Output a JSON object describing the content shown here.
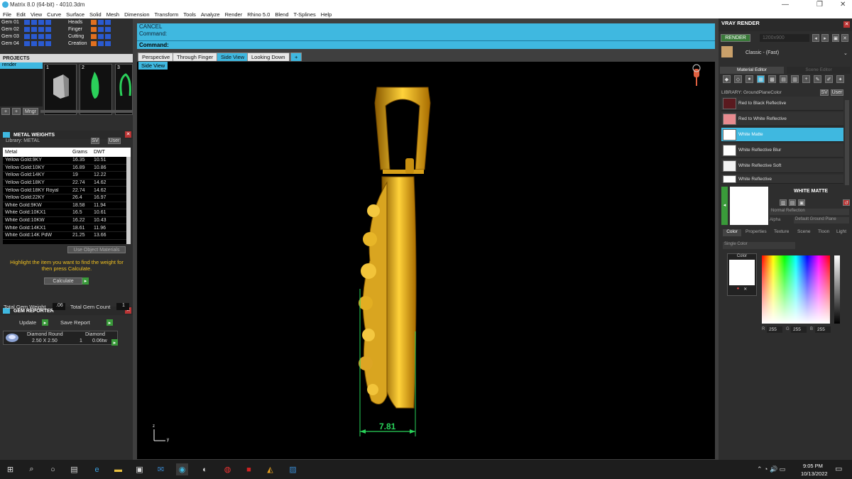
{
  "window": {
    "title": "Matrix 8.0 (64-bit) - 4010.3dm",
    "min": "—",
    "max": "❐",
    "close": "✕"
  },
  "menu": [
    "File",
    "Edit",
    "View",
    "Curve",
    "Surface",
    "Solid",
    "Mesh",
    "Dimension",
    "Transform",
    "Tools",
    "Analyze",
    "Render",
    "Rhino 5.0",
    "Blend",
    "T-Splines",
    "Help"
  ],
  "gems_left": [
    "Gem 01",
    "Gem 02",
    "Gem 03",
    "Gem 04"
  ],
  "gems_right": [
    "Heads",
    "Finger",
    "Cutting",
    "Creation"
  ],
  "projects": {
    "title": "PROJECTS",
    "item": "render",
    "thumb_nums": [
      "1",
      "2",
      "3"
    ],
    "mngr": "Mngr"
  },
  "metal_weights": {
    "title": "METAL WEIGHTS",
    "library_label": "Library: METAL",
    "sv": "SV",
    "user": "User",
    "headers": [
      "Metal",
      "Grams",
      "DWT"
    ],
    "rows": [
      [
        "Yellow Gold:9KY",
        "16.35",
        "10.51"
      ],
      [
        "Yellow Gold:10KY",
        "16.89",
        "10.86"
      ],
      [
        "Yellow Gold:14KY",
        "19",
        "12.22"
      ],
      [
        "Yellow Gold:18KY",
        "22.74",
        "14.62"
      ],
      [
        "Yellow Gold:18KY Royal",
        "22.74",
        "14.62"
      ],
      [
        "Yellow Gold:22KY",
        "26.4",
        "16.97"
      ],
      [
        "White Gold:9KW",
        "18.58",
        "11.94"
      ],
      [
        "White Gold:10KX1",
        "16.5",
        "10.61"
      ],
      [
        "White Gold:10KW",
        "16.22",
        "10.43"
      ],
      [
        "White Gold:14KX1",
        "18.61",
        "11.96"
      ],
      [
        "White Gold:14K PdW",
        "21.25",
        "13.66"
      ]
    ],
    "use_object": "Use Object Materials",
    "hint": "Highlight the item you want to find the weight for then press Calculate.",
    "calculate": "Calculate"
  },
  "gem_reporter": {
    "title": "GEM REPORTER",
    "total_weight_label": "Total Gem Weight",
    "total_weight_value": ".06",
    "total_count_label": "Total Gem Count",
    "total_count_value": "1",
    "update": "Update",
    "save_report": "Save Report",
    "headers": [
      "Diamond Round",
      "Diamond"
    ],
    "row": {
      "size": "2.50 X 2.50",
      "qty": "1",
      "ct": "0.06tw"
    }
  },
  "command": {
    "line1": "CANCEL",
    "line2": "Command:",
    "prompt": "Command:"
  },
  "viewport_tabs": [
    "Perspective",
    "Through Finger",
    "Side View",
    "Looking Down",
    "+"
  ],
  "active_view": "Side View",
  "viewport_label": "Side View",
  "dimension": "7.81",
  "axis": {
    "z": "z",
    "y": "y"
  },
  "vray": {
    "title": "VRAY RENDER",
    "render_btn": "RENDER",
    "resolution": "1200x900",
    "preset": "Classic - (Fast)",
    "tab_material": "Material Editor",
    "tab_scene": "Scene Editor",
    "library": "LIBRARY: GroundPlaneColor",
    "sv": "SV",
    "user": "User",
    "materials": [
      {
        "name": "Red to Black Reflective",
        "color": "#5a1a1f"
      },
      {
        "name": "Red to White Reflective",
        "color": "#e88b8f"
      },
      {
        "name": "White Matte",
        "color": "#ffffff"
      },
      {
        "name": "White Reflective Blur",
        "color": "#ffffff"
      },
      {
        "name": "White Reflective Soft",
        "color": "#f2f2f2"
      },
      {
        "name": "White Reflective",
        "color": "#ffffff"
      }
    ],
    "selected": "White Matte",
    "selected_title": "WHITE MATTE",
    "reflection": "Normal Reflection",
    "alpha": "Alpha",
    "ground": "Default Ground Plane",
    "bottom_tabs": [
      "Color",
      "Properties",
      "Texture",
      "Scene",
      "Tloon",
      "Light"
    ],
    "color_mode": "Single Color",
    "color_label": "Color",
    "rgb": {
      "r": "255",
      "g": "255",
      "b": "255"
    }
  },
  "taskbar": {
    "time": "9:05 PM",
    "date": "10/13/2022"
  },
  "colors": {
    "accent": "#3fb8e0",
    "gold": "#e0b020",
    "dim": "#29d35a"
  }
}
